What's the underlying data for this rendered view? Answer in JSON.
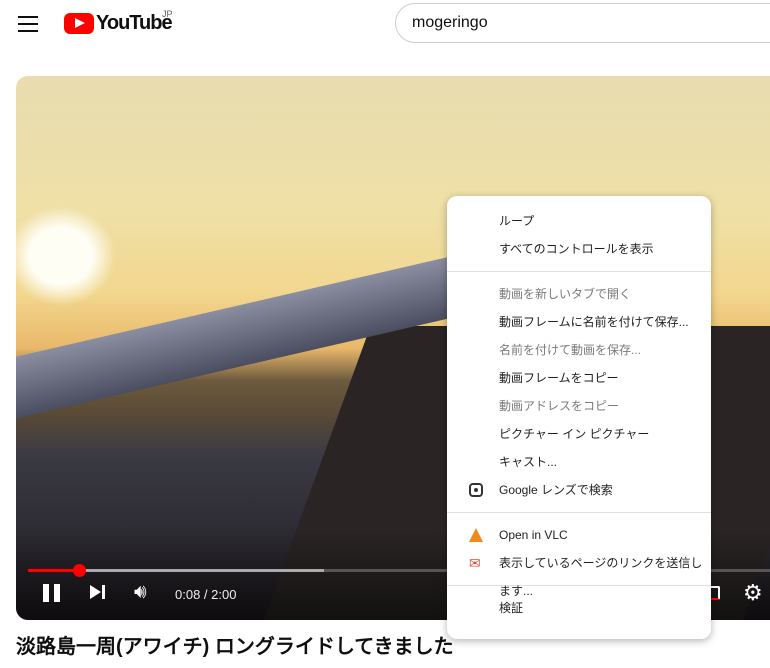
{
  "header": {
    "logo_text": "YouTube",
    "region": "JP",
    "search_value": "mogeringo"
  },
  "player": {
    "time": "0:08 / 2:00",
    "progress_percent": 6.7,
    "buffered_percent": 39,
    "accent": "#ff0000"
  },
  "video_title": "淡路島一周(アワイチ) ロングライドしてきました",
  "context_menu": {
    "items": [
      {
        "label": "ループ",
        "enabled": true
      },
      {
        "label": "すべてのコントロールを表示",
        "enabled": true
      },
      {
        "label": "動画を新しいタブで開く",
        "enabled": false
      },
      {
        "label": "動画フレームに名前を付けて保存...",
        "enabled": true
      },
      {
        "label": "名前を付けて動画を保存...",
        "enabled": false
      },
      {
        "label": "動画フレームをコピー",
        "enabled": true
      },
      {
        "label": "動画アドレスをコピー",
        "enabled": false
      },
      {
        "label": "ピクチャー イン ピクチャー",
        "enabled": true
      },
      {
        "label": "キャスト...",
        "enabled": true
      },
      {
        "label": "Google レンズで検索",
        "enabled": true,
        "icon": "google-lens-icon"
      },
      {
        "label": "Open in VLC",
        "enabled": true,
        "icon": "vlc-icon"
      },
      {
        "label": "表示しているページのリンクを送信します...",
        "enabled": true,
        "icon": "mail-icon"
      },
      {
        "label": "検証",
        "enabled": true
      }
    ]
  }
}
